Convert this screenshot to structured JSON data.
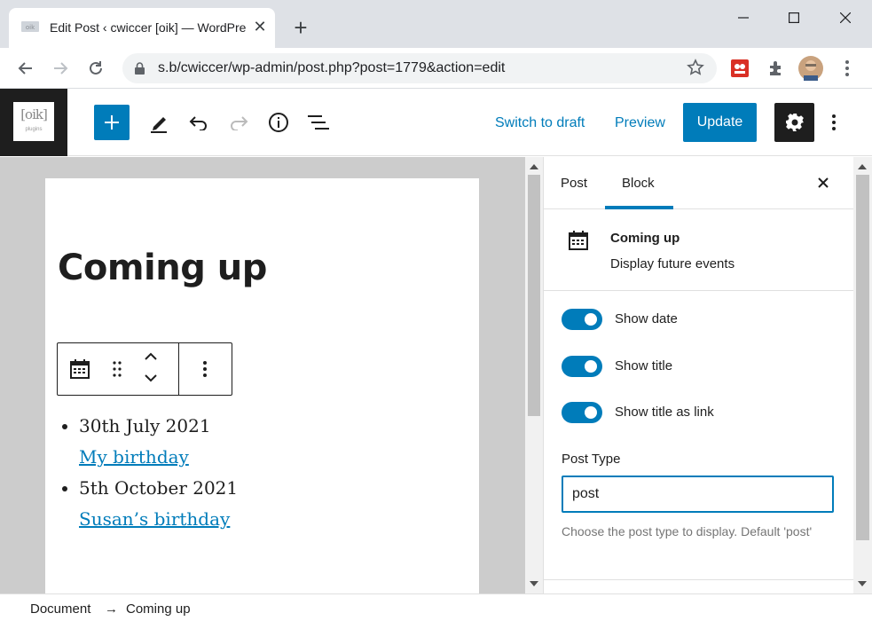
{
  "browser": {
    "tab_title": "Edit Post ‹ cwiccer [oik] — WordPress",
    "tab_close": "✕",
    "new_tab": "+",
    "url": "s.b/cwiccer/wp-admin/post.php?post=1779&action=edit"
  },
  "wp_header": {
    "logo_text": "[oik]",
    "logo_subtext": "plugins",
    "switch_to_draft": "Switch to draft",
    "preview": "Preview",
    "update": "Update"
  },
  "editor": {
    "post_title": "Coming up",
    "events": [
      {
        "date": "30th July 2021",
        "title": "My birthday"
      },
      {
        "date": "5th October 2021",
        "title": "Susan’s birthday"
      }
    ]
  },
  "sidebar": {
    "tabs": [
      {
        "label": "Post",
        "active": false
      },
      {
        "label": "Block",
        "active": true
      }
    ],
    "block_card": {
      "title": "Coming up",
      "description": "Display future events"
    },
    "toggles": [
      {
        "label": "Show date",
        "checked": true
      },
      {
        "label": "Show title",
        "checked": true
      },
      {
        "label": "Show title as link",
        "checked": true
      }
    ],
    "post_type": {
      "label": "Post Type",
      "value": "post",
      "help": "Choose the post type to display. Default 'post'"
    }
  },
  "footer": {
    "crumbs": [
      "Document",
      "→",
      "Coming up"
    ]
  },
  "colors": {
    "accent": "#007cba",
    "dark": "#1e1e1e",
    "canvas_bg": "#cccccc",
    "chrome_bg": "#dee1e6"
  },
  "icons": {
    "tab": [
      "favicon-icon",
      "close-icon"
    ],
    "window": [
      "minimize-icon",
      "maximize-icon",
      "window-close-icon"
    ],
    "nav": [
      "back-arrow-icon",
      "forward-arrow-icon",
      "reload-icon",
      "lock-icon",
      "star-icon",
      "extension-icon",
      "puzzle-icon",
      "avatar",
      "chrome-menu-icon"
    ],
    "header": [
      "plus-icon",
      "pencil-icon",
      "undo-icon",
      "redo-icon",
      "info-icon",
      "list-view-icon",
      "gear-icon",
      "kebab-icon"
    ],
    "block": [
      "calendar-icon",
      "drag-handle-icon",
      "chevron-up-icon",
      "chevron-down-icon",
      "kebab-icon"
    ]
  }
}
